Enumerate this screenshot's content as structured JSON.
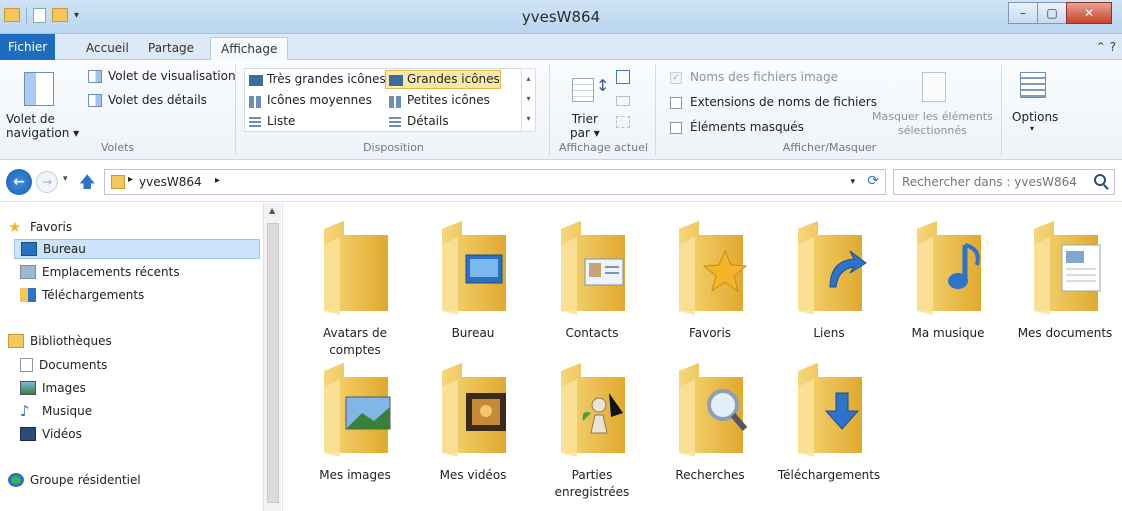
{
  "window": {
    "title": "yvesW864"
  },
  "tabs": {
    "fichier": "Fichier",
    "accueil": "Accueil",
    "partage": "Partage",
    "affichage": "Affichage"
  },
  "ribbon": {
    "volets": {
      "navigation_pane": "Volet de\nnavigation ▾",
      "preview_pane": "Volet de visualisation",
      "details_pane": "Volet des détails",
      "label": "Volets"
    },
    "disposition": {
      "items": [
        "Très grandes icônes",
        "Grandes icônes",
        "Icônes moyennes",
        "Petites icônes",
        "Liste",
        "Détails"
      ],
      "selected": "Grandes icônes",
      "label": "Disposition"
    },
    "affichage_actuel": {
      "sort": "Trier\npar ▾",
      "label": "Affichage actuel"
    },
    "afficher_masquer": {
      "checkboxes": [
        "Noms des fichiers image",
        "Extensions de noms de fichiers",
        "Éléments masqués"
      ],
      "hide_selected": "Masquer les éléments\nsélectionnés",
      "label": "Afficher/Masquer"
    },
    "options": {
      "label": "Options"
    }
  },
  "address": {
    "path": "yvesW864"
  },
  "search": {
    "placeholder": "Rechercher dans : yvesW864"
  },
  "sidebar": {
    "favoris": "Favoris",
    "favoris_items": [
      "Bureau",
      "Emplacements récents",
      "Téléchargements"
    ],
    "bibliotheques": "Bibliothèques",
    "bibliotheques_items": [
      "Documents",
      "Images",
      "Musique",
      "Vidéos"
    ],
    "groupe": "Groupe résidentiel"
  },
  "folders": [
    {
      "name": "Avatars de\ncomptes",
      "icon": "avatars-icon"
    },
    {
      "name": "Bureau",
      "icon": "desktop-icon"
    },
    {
      "name": "Contacts",
      "icon": "contact-card-icon"
    },
    {
      "name": "Favoris",
      "icon": "star-icon"
    },
    {
      "name": "Liens",
      "icon": "link-arrow-icon"
    },
    {
      "name": "Ma musique",
      "icon": "music-note-icon"
    },
    {
      "name": "Mes documents",
      "icon": "document-icon"
    },
    {
      "name": "Mes images",
      "icon": "picture-icon"
    },
    {
      "name": "Mes vidéos",
      "icon": "film-icon"
    },
    {
      "name": "Parties\nenregistrées",
      "icon": "chess-pawn-icon"
    },
    {
      "name": "Recherches",
      "icon": "magnifier-icon"
    },
    {
      "name": "Téléchargements",
      "icon": "download-arrow-icon"
    }
  ]
}
